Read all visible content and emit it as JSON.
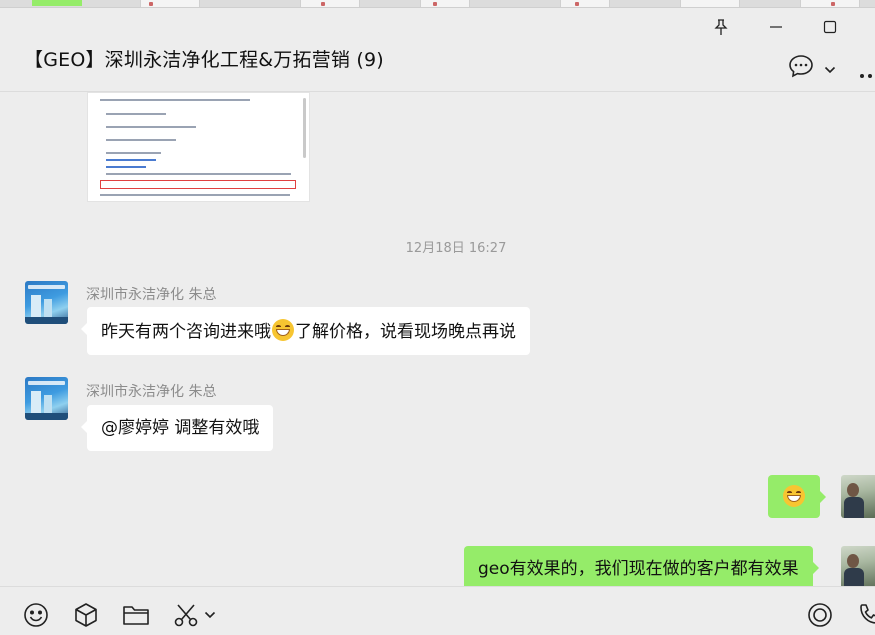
{
  "window": {
    "pin_icon": "pin-icon",
    "minimize_icon": "minimize-icon",
    "maximize_icon": "maximize-icon"
  },
  "header": {
    "title": "【GEO】深圳永洁净化工程&万拓营销 (9)",
    "chat_info_icon": "chat-bubble-icon",
    "dropdown_icon": "chevron-down-icon",
    "more_icon": "more-icon"
  },
  "messages": {
    "timestamp": "12月18日 16:27",
    "msg1": {
      "sender": "深圳市永洁净化  朱总",
      "text_before": "昨天有两个咨询进来哦",
      "emoji": "grin-emoji",
      "text_after": "了解价格，说看现场晚点再说"
    },
    "msg2": {
      "sender": "深圳市永洁净化  朱总",
      "text": "@廖婷婷 调整有效哦"
    },
    "msg3": {
      "emoji": "grin-emoji"
    },
    "msg4": {
      "text": "geo有效果的，我们现在做的客户都有效果"
    }
  },
  "toolbar": {
    "emoji_icon": "smiley-icon",
    "package_icon": "cube-icon",
    "folder_icon": "folder-icon",
    "scissors_icon": "scissors-icon",
    "scissors_dropdown_icon": "chevron-down-icon",
    "record_icon": "circle-icon",
    "call_icon": "phone-icon"
  },
  "colors": {
    "background": "#ededed",
    "bubble_self": "#95ec69",
    "bubble_other": "#ffffff",
    "meta_text": "#9a9a9a"
  }
}
